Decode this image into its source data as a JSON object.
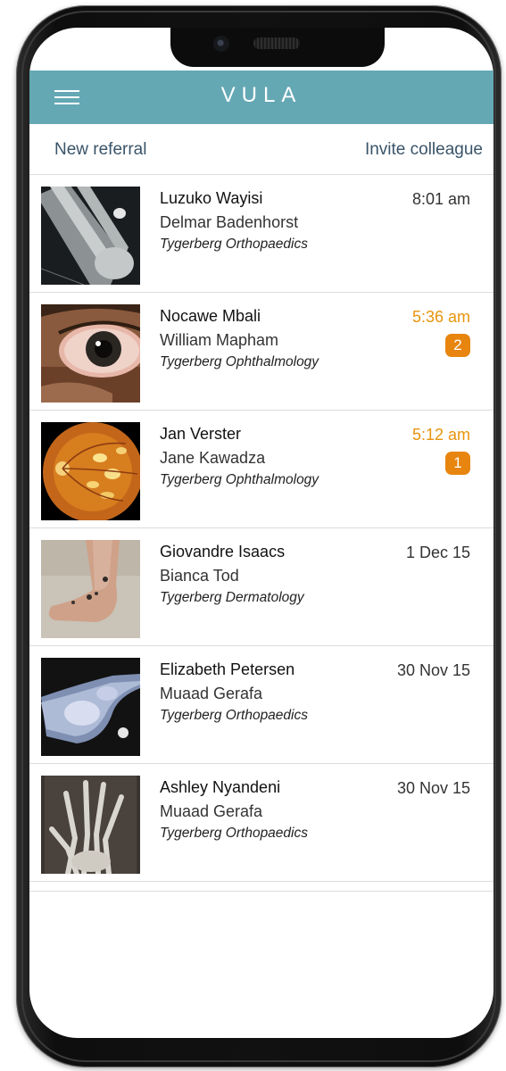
{
  "app": {
    "title": "VULA"
  },
  "actions": {
    "new_referral": "New referral",
    "invite_colleague": "Invite colleague"
  },
  "colors": {
    "header": "#64a8b4",
    "unread": "#e8940e",
    "badge": "#e7850f",
    "link": "#3a5469"
  },
  "referrals": [
    {
      "patient": "Luzuko Wayisi",
      "doctor": "Delmar Badenhorst",
      "department": "Tygerberg Orthopaedics",
      "time": "8:01 am",
      "unread": false,
      "image": "xray-leg"
    },
    {
      "patient": "Nocawe Mbali",
      "doctor": "William Mapham",
      "department": "Tygerberg Ophthalmology",
      "time": "5:36 am",
      "unread": true,
      "badge": "2",
      "image": "eye"
    },
    {
      "patient": "Jan Verster",
      "doctor": "Jane Kawadza",
      "department": "Tygerberg Ophthalmology",
      "time": "5:12 am",
      "unread": true,
      "badge": "1",
      "image": "retina"
    },
    {
      "patient": "Giovandre Isaacs",
      "doctor": "Bianca Tod",
      "department": "Tygerberg Dermatology",
      "time": "1 Dec 15",
      "unread": false,
      "image": "foot-skin"
    },
    {
      "patient": "Elizabeth Petersen",
      "doctor": "Muaad Gerafa",
      "department": "Tygerberg Orthopaedics",
      "time": "30 Nov 15",
      "unread": false,
      "image": "xray-foot"
    },
    {
      "patient": "Ashley Nyandeni",
      "doctor": "Muaad Gerafa",
      "department": "Tygerberg Orthopaedics",
      "time": "30 Nov 15",
      "unread": false,
      "image": "xray-hand"
    }
  ]
}
